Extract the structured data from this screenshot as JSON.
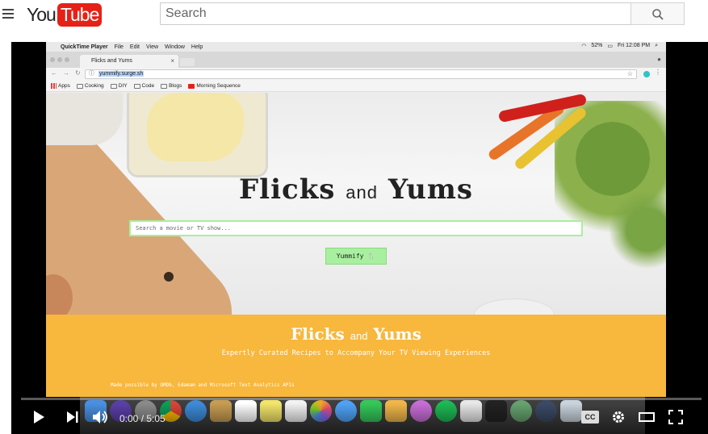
{
  "youtube": {
    "logo_you": "You",
    "logo_tube": "Tube",
    "search_placeholder": "Search"
  },
  "mac_menubar": {
    "app_name": "QuickTime Player",
    "menus": [
      "File",
      "Edit",
      "View",
      "Window",
      "Help"
    ],
    "battery": "52%",
    "clock": "Fri 12:08 PM"
  },
  "browser": {
    "tab_title": "Flicks and Yums",
    "url": "yummify.surge.sh",
    "bookmarks": [
      "Apps",
      "Cooking",
      "DIY",
      "Code",
      "Blogs",
      "Morning Sequence"
    ]
  },
  "site": {
    "title_word1": "Flicks",
    "title_and": "and",
    "title_word2": "Yums",
    "search_placeholder": "Search a movie or TV show...",
    "button_label": "Yummify 🍴",
    "footer_title_word1": "Flicks",
    "footer_title_and": "and",
    "footer_title_word2": "Yums",
    "footer_subtitle": "Expertly Curated Recipes to Accompany Your TV Viewing Experiences",
    "footer_credit": "Made possible by OMDb, Edamam and Microsoft Text Analytics APIs"
  },
  "player": {
    "time_display": "0:00 / 5:05",
    "cc_label": "CC",
    "progress_fraction": 0.0
  },
  "colors": {
    "yt_red": "#e62117",
    "site_orange": "#f8b73d",
    "site_green": "#a8f0a0"
  },
  "dock_icons": [
    "finder-icon",
    "siri-icon",
    "launchpad-icon",
    "chrome-icon",
    "safari-icon",
    "notes-icon",
    "calendar-icon",
    "stickies-icon",
    "reminders-icon",
    "photos-icon",
    "messages-icon",
    "facetime-icon",
    "preview-icon",
    "itunes-icon",
    "spotify-icon",
    "slack-icon",
    "terminal-icon",
    "atom-icon",
    "quicktime-icon",
    "trash-icon"
  ]
}
